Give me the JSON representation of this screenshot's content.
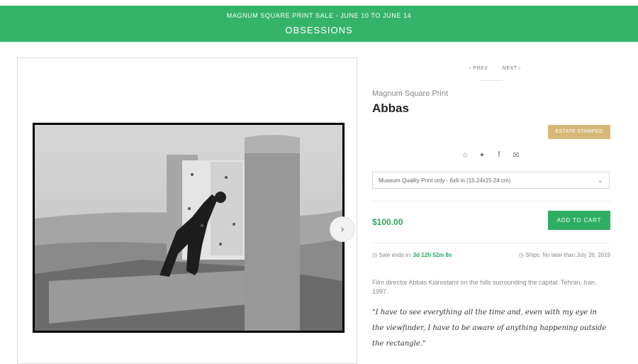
{
  "banner": {
    "sale_text": "MAGNUM SQUARE PRINT SALE - JUNE 10 TO JUNE 14",
    "title": "OBSESSIONS",
    "color": "#36b36b"
  },
  "gallery": {
    "image_alt": "Film director Abbas Kiarostami on the hills surrounding the capital",
    "next_arrow": "›"
  },
  "pager": {
    "prev": "‹ PREV",
    "next": "NEXT ›"
  },
  "product": {
    "eyebrow": "Magnum Square Print",
    "artist": "Abbas",
    "badge": "ESTATE STAMPED",
    "share_icons": [
      "star-icon",
      "twitter-icon",
      "facebook-icon",
      "email-icon"
    ],
    "option_selected": "Museum Quality Print only - 6x6 in (15.24x15.24 cm)",
    "price": "$100.00",
    "cart_label": "ADD TO CART",
    "sale_ends_label": "Sale ends in:",
    "sale_ends_value": "3d 12h 52m 8s",
    "ships": "Ships: No later than July 26, 2019",
    "caption": "Film director Abbas Kiarostami on the hills surrounding the capital. Tehran, Iran. 1997.",
    "quote": "\"I have to see everything all the time and, even with my eye in the viewfinder, I have to be aware of anything happening outside the rectangle.\""
  }
}
